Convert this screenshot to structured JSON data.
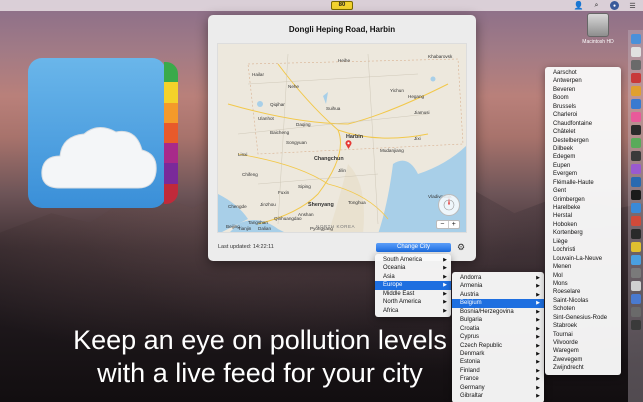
{
  "menubar": {
    "aqi_value": "80",
    "right_icons": [
      "user-icon",
      "search-icon",
      "user-circle-icon",
      "list-icon"
    ]
  },
  "desktop": {
    "drive_label": "Macintosh HD"
  },
  "window": {
    "title": "Dongli Heping Road, Harbin",
    "last_updated": "Last updated: 14:22:11",
    "change_city_label": "Change City",
    "map": {
      "labels": [
        "Hailar",
        "Heihe",
        "Khabarovsk",
        "Nehe",
        "Qiqihar",
        "Suihua",
        "Daqing",
        "Harbin",
        "Jiamusi",
        "Jixi",
        "Songyuan",
        "Mudanjiang",
        "Vladivostok",
        "Changchun",
        "Jilin",
        "Siping",
        "Tonghua",
        "Shenyang",
        "Dalian",
        "NORTH KOREA",
        "Pyongyang",
        "Chengde",
        "Beijing",
        "Tangshan",
        "Tianjin",
        "Qinhuangdao",
        "Fuxin",
        "Jinzhou",
        "Anshan",
        "Linxi",
        "Chifeng",
        "Baicheng",
        "Ulanhot",
        "Yichun",
        "Hegang"
      ],
      "zoom_in": "+",
      "zoom_out": "−"
    }
  },
  "continents_menu": {
    "items": [
      {
        "label": "South America",
        "selected": false
      },
      {
        "label": "Oceania",
        "selected": false
      },
      {
        "label": "Asia",
        "selected": false
      },
      {
        "label": "Europe",
        "selected": true
      },
      {
        "label": "Middle East",
        "selected": false
      },
      {
        "label": "North America",
        "selected": false
      },
      {
        "label": "Africa",
        "selected": false
      }
    ]
  },
  "countries_menu": {
    "items": [
      {
        "label": "Andorra",
        "selected": false
      },
      {
        "label": "Armenia",
        "selected": false
      },
      {
        "label": "Austria",
        "selected": false
      },
      {
        "label": "Belgium",
        "selected": true
      },
      {
        "label": "Bosnia/Herzegovina",
        "selected": false
      },
      {
        "label": "Bulgaria",
        "selected": false
      },
      {
        "label": "Croatia",
        "selected": false
      },
      {
        "label": "Cyprus",
        "selected": false
      },
      {
        "label": "Czech Republic",
        "selected": false
      },
      {
        "label": "Denmark",
        "selected": false
      },
      {
        "label": "Estonia",
        "selected": false
      },
      {
        "label": "Finland",
        "selected": false
      },
      {
        "label": "France",
        "selected": false
      },
      {
        "label": "Germany",
        "selected": false
      },
      {
        "label": "Gibraltar",
        "selected": false
      }
    ]
  },
  "cities_menu": {
    "items": [
      "Aarschot",
      "Antwerpen",
      "Beveren",
      "Boom",
      "Brussels",
      "Charleroi",
      "Chaudfontaine",
      "Châtelet",
      "Destelbergen",
      "Dilbeek",
      "Edegem",
      "Eupen",
      "Evergem",
      "Flémalle-Haute",
      "Gent",
      "Grimbergen",
      "Harelbeke",
      "Herstal",
      "Hoboken",
      "Kortenberg",
      "Liège",
      "Lochristi",
      "Louvain-La-Neuve",
      "Menen",
      "Mol",
      "Mons",
      "Roeselare",
      "Saint-Nicolas",
      "Schoten",
      "Sint-Genesius-Rode",
      "Stabroek",
      "Tournai",
      "Vilvoorde",
      "Waregem",
      "Zwevegem",
      "Zwijndrecht"
    ]
  },
  "tagline": {
    "line1": "Keep an eye on pollution levels",
    "line2": "with a live feed for your city"
  },
  "colors": {
    "aqi_badge": "#f2d22e",
    "selection": "#1e6fe0",
    "spine": [
      "#3aaa4a",
      "#f4d22a",
      "#f49a2a",
      "#e85a2a",
      "#a82a8a",
      "#7a2a9a",
      "#c02a3a"
    ]
  }
}
